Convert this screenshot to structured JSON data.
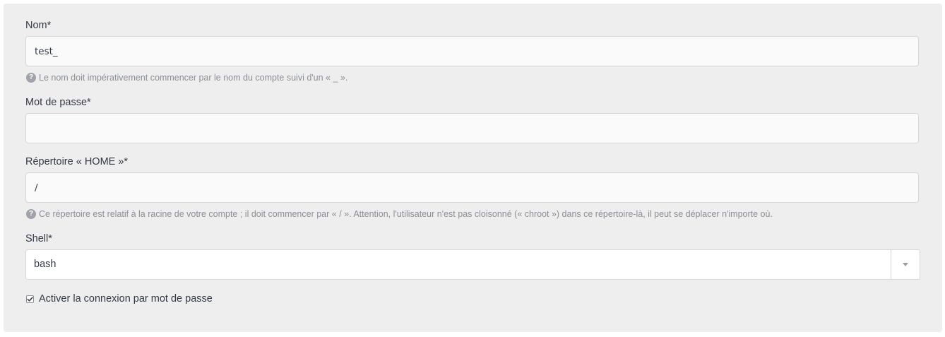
{
  "form": {
    "name": {
      "label": "Nom*",
      "value": "test_",
      "help": "Le nom doit impérativement commencer par le nom du compte suivi d'un « _ »."
    },
    "password": {
      "label": "Mot de passe*",
      "value": ""
    },
    "home": {
      "label": "Répertoire « HOME »*",
      "value": "/",
      "help": "Ce répertoire est relatif à la racine de votre compte ; il doit commencer par « / ». Attention, l'utilisateur n'est pas cloisonné (« chroot ») dans ce répertoire-là, il peut se déplacer n'importe où."
    },
    "shell": {
      "label": "Shell*",
      "selected": "bash"
    },
    "password_login": {
      "label": "Activer la connexion par mot de passe",
      "checked": true
    }
  },
  "icons": {
    "help": "question-circle-icon",
    "select": "caret-down-icon",
    "check": "check-icon"
  },
  "help_icon_glyph": "?"
}
